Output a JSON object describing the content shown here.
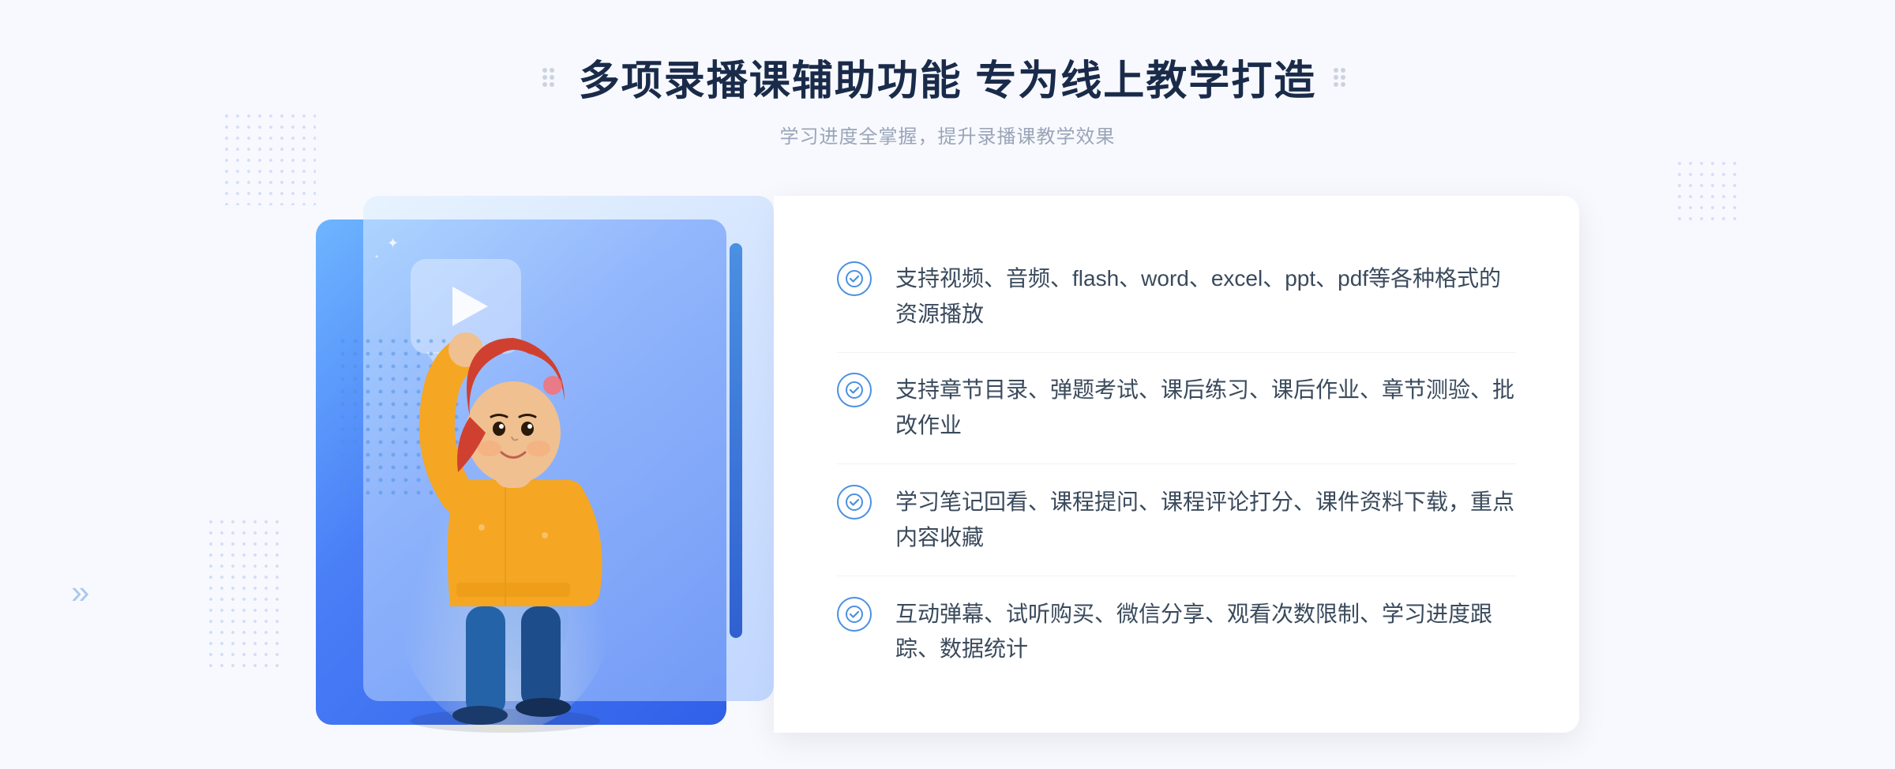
{
  "header": {
    "title": "多项录播课辅助功能 专为线上教学打造",
    "subtitle": "学习进度全掌握，提升录播课教学效果"
  },
  "features": [
    {
      "id": 1,
      "text": "支持视频、音频、flash、word、excel、ppt、pdf等各种格式的资源播放"
    },
    {
      "id": 2,
      "text": "支持章节目录、弹题考试、课后练习、课后作业、章节测验、批改作业"
    },
    {
      "id": 3,
      "text": "学习笔记回看、课程提问、课程评论打分、课件资料下载，重点内容收藏"
    },
    {
      "id": 4,
      "text": "互动弹幕、试听购买、微信分享、观看次数限制、学习进度跟踪、数据统计"
    }
  ],
  "icons": {
    "check": "✓",
    "play": "▶",
    "chevron_left": "«",
    "chevron_double": "»"
  },
  "colors": {
    "primary": "#4a90e2",
    "title": "#1a2b4a",
    "text": "#3a4a5c",
    "subtitle": "#9aa5b8",
    "bg": "#f8f9fe"
  }
}
